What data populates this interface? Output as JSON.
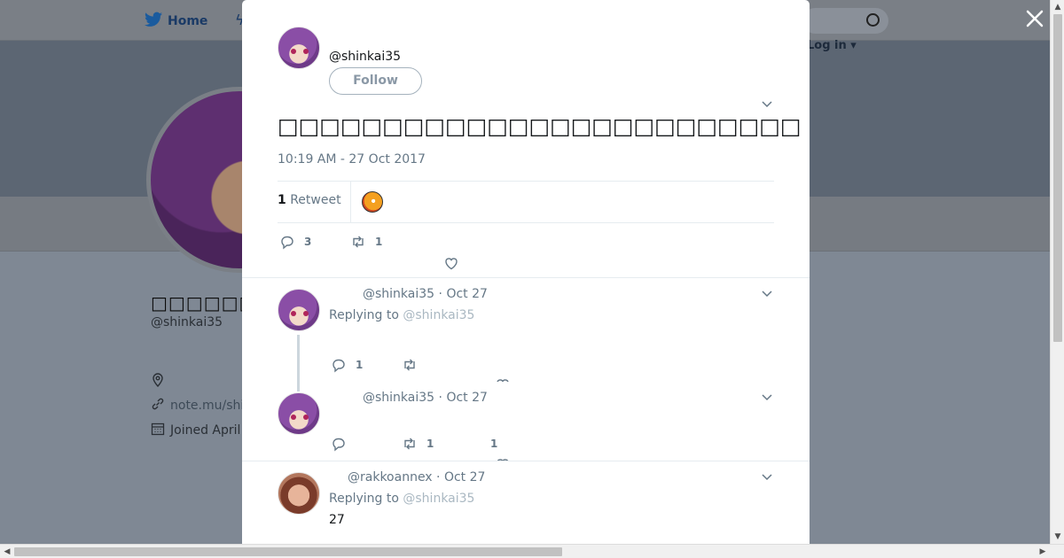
{
  "nav": {
    "home_label": "Home",
    "login_label": "Log in"
  },
  "profile_bg": {
    "name": "□□□□□□□□□",
    "handle": "@shinkai35",
    "link": "note.mu/shi",
    "joined": "Joined April"
  },
  "tweet": {
    "handle": "@shinkai35",
    "follow_label": "Follow",
    "text": "□□□□□□□□□□□□□□□□□□□□□□□□□□□□□□□□□□□□□□□□□□□□□□□□□□□□□□□□□□□□□□□□□□□□",
    "time": "10:19 AM - 27 Oct 2017",
    "retweet_count": "1",
    "retweet_label": "Retweet",
    "actions": {
      "reply": "3",
      "retweet": "1",
      "like": ""
    }
  },
  "replies": [
    {
      "handle": "@shinkai35",
      "date": "Oct 27",
      "replying_label": "Replying to",
      "replying_to": "@shinkai35",
      "text": "",
      "actions": {
        "reply": "1",
        "retweet": "",
        "like": ""
      }
    },
    {
      "handle": "@shinkai35",
      "date": "Oct 27",
      "text": "",
      "actions": {
        "reply": "",
        "retweet": "1",
        "like": "1"
      }
    },
    {
      "handle": "@rakkoannex",
      "date": "Oct 27",
      "replying_label": "Replying to",
      "replying_to": "@shinkai35",
      "text": "27"
    }
  ],
  "colors": {
    "overlay": "#7f8894",
    "muted": "#657786",
    "border": "#e6ecf0",
    "reply_link": "#aab8c2"
  }
}
